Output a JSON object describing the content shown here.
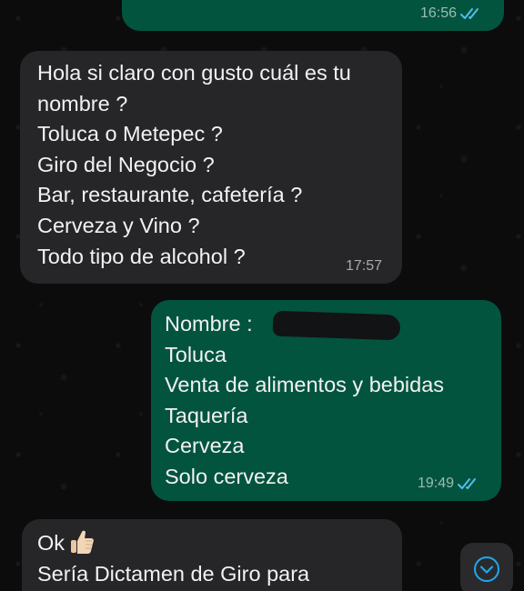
{
  "messages": [
    {
      "direction": "outgoing",
      "lines": [],
      "time": "16:56",
      "read": true
    },
    {
      "direction": "incoming",
      "lines": [
        "Hola si claro con gusto cuál es tu",
        "nombre ?",
        "Toluca o Metepec ?",
        "Giro del Negocio ?",
        "Bar, restaurante, cafetería ?",
        "Cerveza y Vino ?",
        "Todo tipo de alcohol ?"
      ],
      "time": "17:57"
    },
    {
      "direction": "outgoing",
      "lines": [
        "Nombre :",
        "Toluca",
        "Venta de alimentos y bebidas",
        "Taquería",
        "Cerveza",
        "Solo cerveza"
      ],
      "time": "19:49",
      "read": true,
      "redacted_field": "nombre"
    },
    {
      "direction": "incoming",
      "lines": [
        "Ok",
        "Sería Dictamen de Giro para"
      ],
      "emoji": "thumbs-up",
      "time": ""
    }
  ],
  "icons": {
    "read_receipt": "double-check-icon",
    "scroll_down": "chevron-down-icon",
    "emoji": "thumbs-up-icon"
  },
  "colors": {
    "background": "#0c0c0c",
    "incoming_bubble": "#262628",
    "outgoing_bubble": "#03543f",
    "read_check": "#53bdeb",
    "scroll_chevron": "#1fa8f2"
  }
}
